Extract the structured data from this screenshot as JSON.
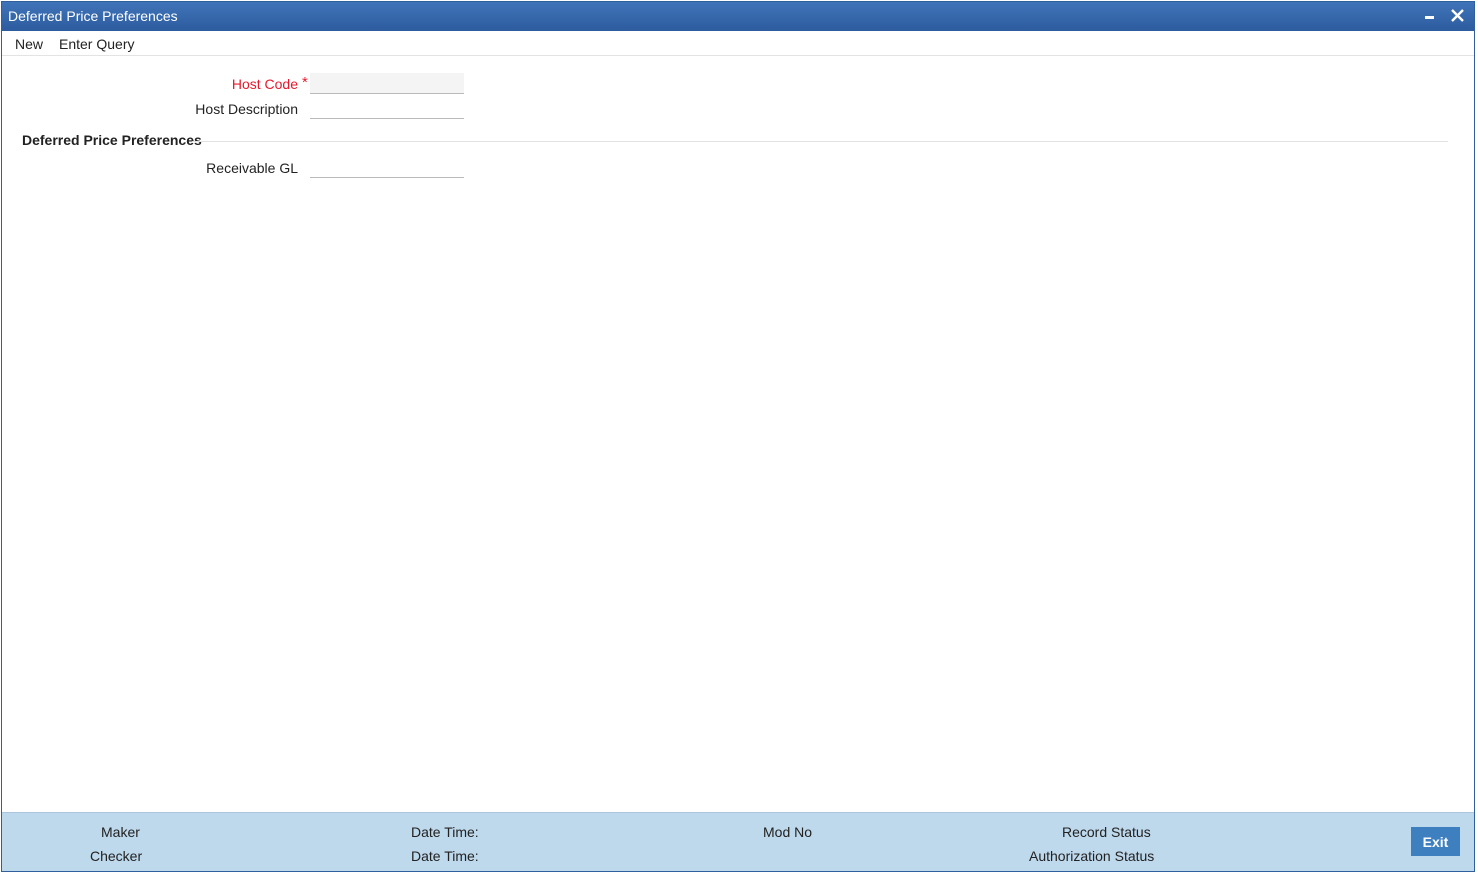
{
  "window": {
    "title": "Deferred Price Preferences",
    "minimize_icon": "minimize-icon",
    "close_icon": "close-icon"
  },
  "menu": {
    "new_label": "New",
    "enter_query_label": "Enter Query"
  },
  "form": {
    "host_code": {
      "label": "Host Code",
      "required_mark": "*",
      "value": ""
    },
    "host_description": {
      "label": "Host Description",
      "value": ""
    },
    "section_title": "Deferred Price Preferences",
    "receivable_gl": {
      "label": "Receivable GL",
      "value": ""
    }
  },
  "footer": {
    "maker_label": "Maker",
    "checker_label": "Checker",
    "maker_datetime_label": "Date Time:",
    "checker_datetime_label": "Date Time:",
    "mod_no_label": "Mod No",
    "record_status_label": "Record Status",
    "authorization_status_label": "Authorization Status",
    "exit_label": "Exit"
  },
  "colors": {
    "titlebar": "#2d5c9f",
    "footer": "#bed8ec",
    "required": "#e8192c",
    "exit_button": "#3d7fbf"
  }
}
